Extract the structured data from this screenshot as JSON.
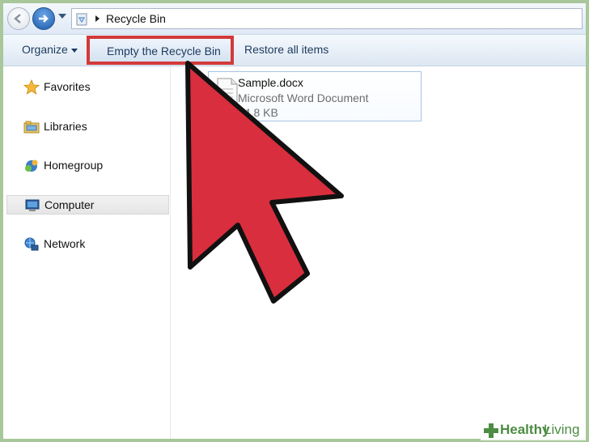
{
  "window": {
    "address": {
      "location": "Recycle Bin",
      "back_icon": "back-arrow-icon",
      "forward_icon": "forward-arrow-icon",
      "location_icon": "recycle-bin-icon"
    }
  },
  "toolbar": {
    "organize_label": "Organize",
    "empty_label": "Empty the Recycle Bin",
    "restore_label": "Restore all items"
  },
  "sidebar": {
    "items": [
      {
        "label": "Favorites",
        "icon": "star-icon"
      },
      {
        "label": "Libraries",
        "icon": "libraries-icon"
      },
      {
        "label": "Homegroup",
        "icon": "homegroup-icon"
      },
      {
        "label": "Computer",
        "icon": "computer-icon",
        "selected": true
      },
      {
        "label": "Network",
        "icon": "network-icon"
      }
    ]
  },
  "files": [
    {
      "name": "Sample.docx",
      "type": "Microsoft Word Document",
      "size": "14.8 KB"
    }
  ],
  "overlay": {
    "arrow_color": "#d92e3d",
    "highlight_color": "#d23a3a"
  },
  "watermark": {
    "brand_bold": "Healthy",
    "brand_light": "Living"
  }
}
